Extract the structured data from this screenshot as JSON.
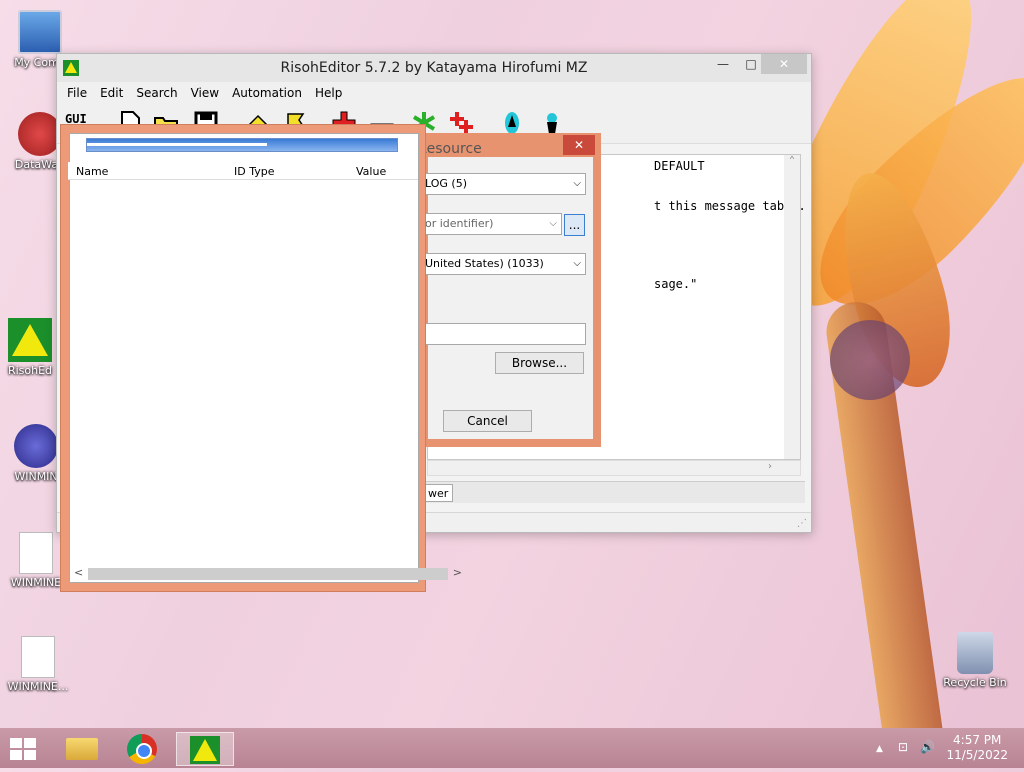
{
  "desktop": {
    "icons": [
      {
        "label": "My Comp"
      },
      {
        "label": "DataWag"
      },
      {
        "label": "RisohEd"
      },
      {
        "label": "WINMIN"
      },
      {
        "label": "WINMINE"
      },
      {
        "label": "WINMINE..."
      },
      {
        "label": "Recycle Bin"
      }
    ]
  },
  "main_window": {
    "title": "RisohEditor 5.7.2 by Katayama Hirofumi MZ",
    "menu": [
      "File",
      "Edit",
      "Search",
      "View",
      "Automation",
      "Help"
    ],
    "toolbar_gui_label": "GUI",
    "code_lines": [
      "DEFAULT",
      "t this message table.",
      "sage.\""
    ],
    "tab_label": "wer",
    "controls": {
      "minimize": "—",
      "maximize": "□",
      "close": "✕"
    }
  },
  "add_resource_dialog": {
    "title": "Add Resource",
    "close": "✕",
    "type_value": "LOG (5)",
    "name_placeholder": "or identifier)",
    "browse_small": "...",
    "language_value": "United States) (1033)",
    "file_value": "",
    "browse_label": "Browse...",
    "cancel_label": "Cancel"
  },
  "float_window": {
    "columns": [
      {
        "label": "Name"
      },
      {
        "label": "ID Type"
      },
      {
        "label": "Value"
      }
    ],
    "scroll_left": "<",
    "scroll_right": ">"
  },
  "taskbar": {
    "time": "4:57 PM",
    "date": "11/5/2022",
    "tray_up": "▲",
    "tray_network": "⊡",
    "tray_volume": "🔊"
  },
  "colors": {
    "dialog_frame": "#e8936f",
    "close_red": "#c94a3a",
    "risoh_green": "#1a8f2a",
    "risoh_yellow": "#f1e90e"
  }
}
